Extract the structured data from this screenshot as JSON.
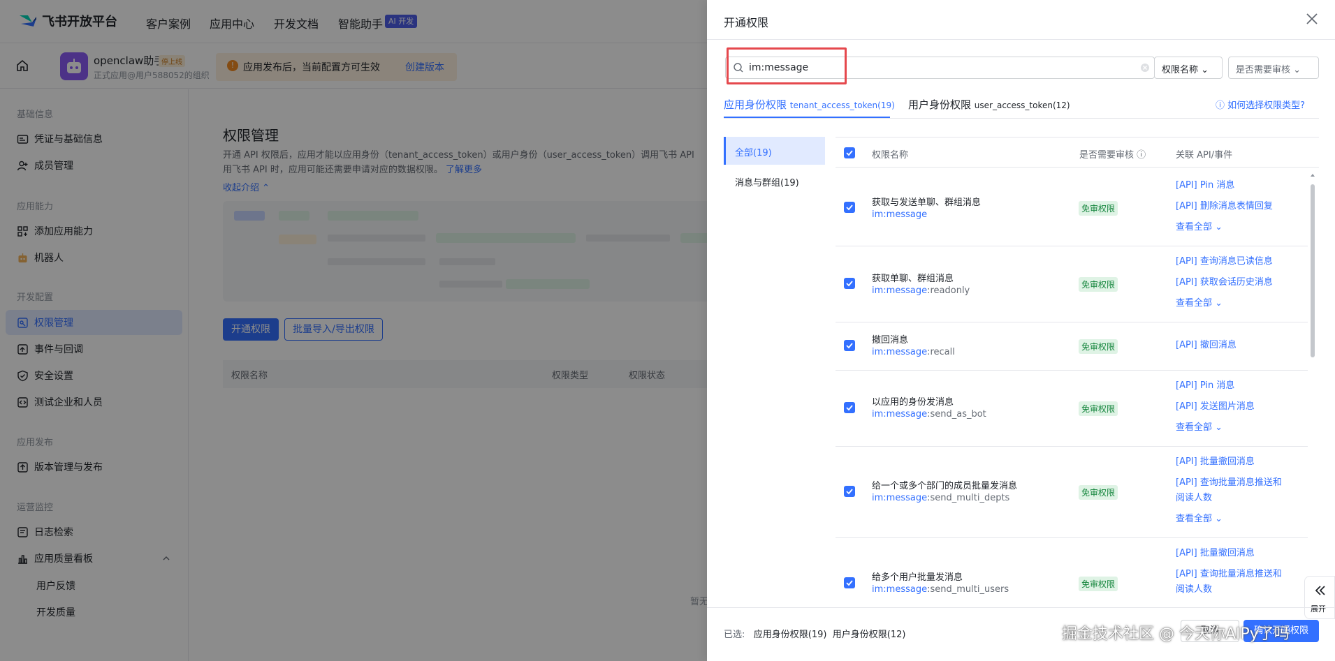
{
  "topbar": {
    "brand": "飞书开放平台",
    "nav": [
      "客户案例",
      "应用中心",
      "开发文档",
      "智能助手"
    ],
    "ai_badge": "AI 开发"
  },
  "appbar": {
    "app_name": "openclaw助手",
    "status_tag": "停上线",
    "subtitle": "正式应用@用户588052的组织",
    "notice": "应用发布后，当前配置方可生效",
    "notice_link": "创建版本"
  },
  "sidebar": {
    "groups": [
      {
        "title": "基础信息",
        "items": [
          "凭证与基础信息",
          "成员管理"
        ]
      },
      {
        "title": "应用能力",
        "items": [
          "添加应用能力",
          "机器人"
        ]
      },
      {
        "title": "开发配置",
        "items": [
          "权限管理",
          "事件与回调",
          "安全设置",
          "测试企业和人员"
        ]
      },
      {
        "title": "应用发布",
        "items": [
          "版本管理与发布"
        ]
      },
      {
        "title": "运营监控",
        "items": [
          "日志检索",
          "应用质量看板",
          "用户反馈",
          "开发质量"
        ]
      }
    ]
  },
  "main": {
    "title": "权限管理",
    "desc1": "开通 API 权限后，应用才能以应用身份（tenant_access_token）或用户身份（user_access_token）调用飞书 API",
    "desc2": "用飞书 API 时，应用可能还需要申请对应的数据权限。",
    "learn_more": "了解更多",
    "collapse": "收起介绍",
    "btn_open": "开通权限",
    "btn_batch": "批量导入/导出权限",
    "col_name": "权限名称",
    "col_type": "权限类型",
    "col_status": "权限状态",
    "empty": "暂无"
  },
  "drawer": {
    "title": "开通权限",
    "search_value": "im:message",
    "select_name": "权限名称",
    "select_review": "是否需要审核",
    "tab_app": "应用身份权限",
    "tab_app_token": "tenant_access_token(19)",
    "tab_user": "用户身份权限",
    "tab_user_token": "user_access_token(12)",
    "help": "如何选择权限类型?",
    "categories": [
      "全部(19)",
      "消息与群组(19)"
    ],
    "col_name": "权限名称",
    "col_review": "是否需要审核",
    "col_api": "关联 API/事件",
    "see_all": "查看全部",
    "rows": [
      {
        "name": "获取与发送单聊、群组消息",
        "scope_hl": "im:message",
        "scope_rest": "",
        "tag": "免审权限",
        "apis": [
          "[API] Pin 消息",
          "[API] 删除消息表情回复"
        ],
        "more": true
      },
      {
        "name": "获取单聊、群组消息",
        "scope_hl": "im:message",
        "scope_rest": ":readonly",
        "tag": "免审权限",
        "apis": [
          "[API] 查询消息已读信息",
          "[API] 获取会话历史消息"
        ],
        "more": true
      },
      {
        "name": "撤回消息",
        "scope_hl": "im:message",
        "scope_rest": ":recall",
        "tag": "免审权限",
        "apis": [
          "[API] 撤回消息"
        ],
        "more": false
      },
      {
        "name": "以应用的身份发消息",
        "scope_hl": "im:message",
        "scope_rest": ":send_as_bot",
        "tag": "免审权限",
        "apis": [
          "[API] Pin 消息",
          "[API] 发送图片消息"
        ],
        "more": true
      },
      {
        "name": "给一个或多个部门的成员批量发消息",
        "scope_hl": "im:message",
        "scope_rest": ":send_multi_depts",
        "tag": "免审权限",
        "apis": [
          "[API] 批量撤回消息",
          "[API] 查询批量消息推送和",
          "阅读人数"
        ],
        "more": true
      },
      {
        "name": "给多个用户批量发消息",
        "scope_hl": "im:message",
        "scope_rest": ":send_multi_users",
        "tag": "免审权限",
        "apis": [
          "[API] 批量撤回消息",
          "[API] 查询批量消息推送和",
          "阅读人数"
        ],
        "more": false
      }
    ],
    "footer_label": "已选:",
    "footer_app": "应用身份权限(19)",
    "footer_user": "用户身份权限(12)",
    "btn_cancel": "取消",
    "btn_confirm": "确认开通权限",
    "expand": "展开"
  },
  "watermark": "掘金技术社区 @ 今天你AIPy了吗"
}
